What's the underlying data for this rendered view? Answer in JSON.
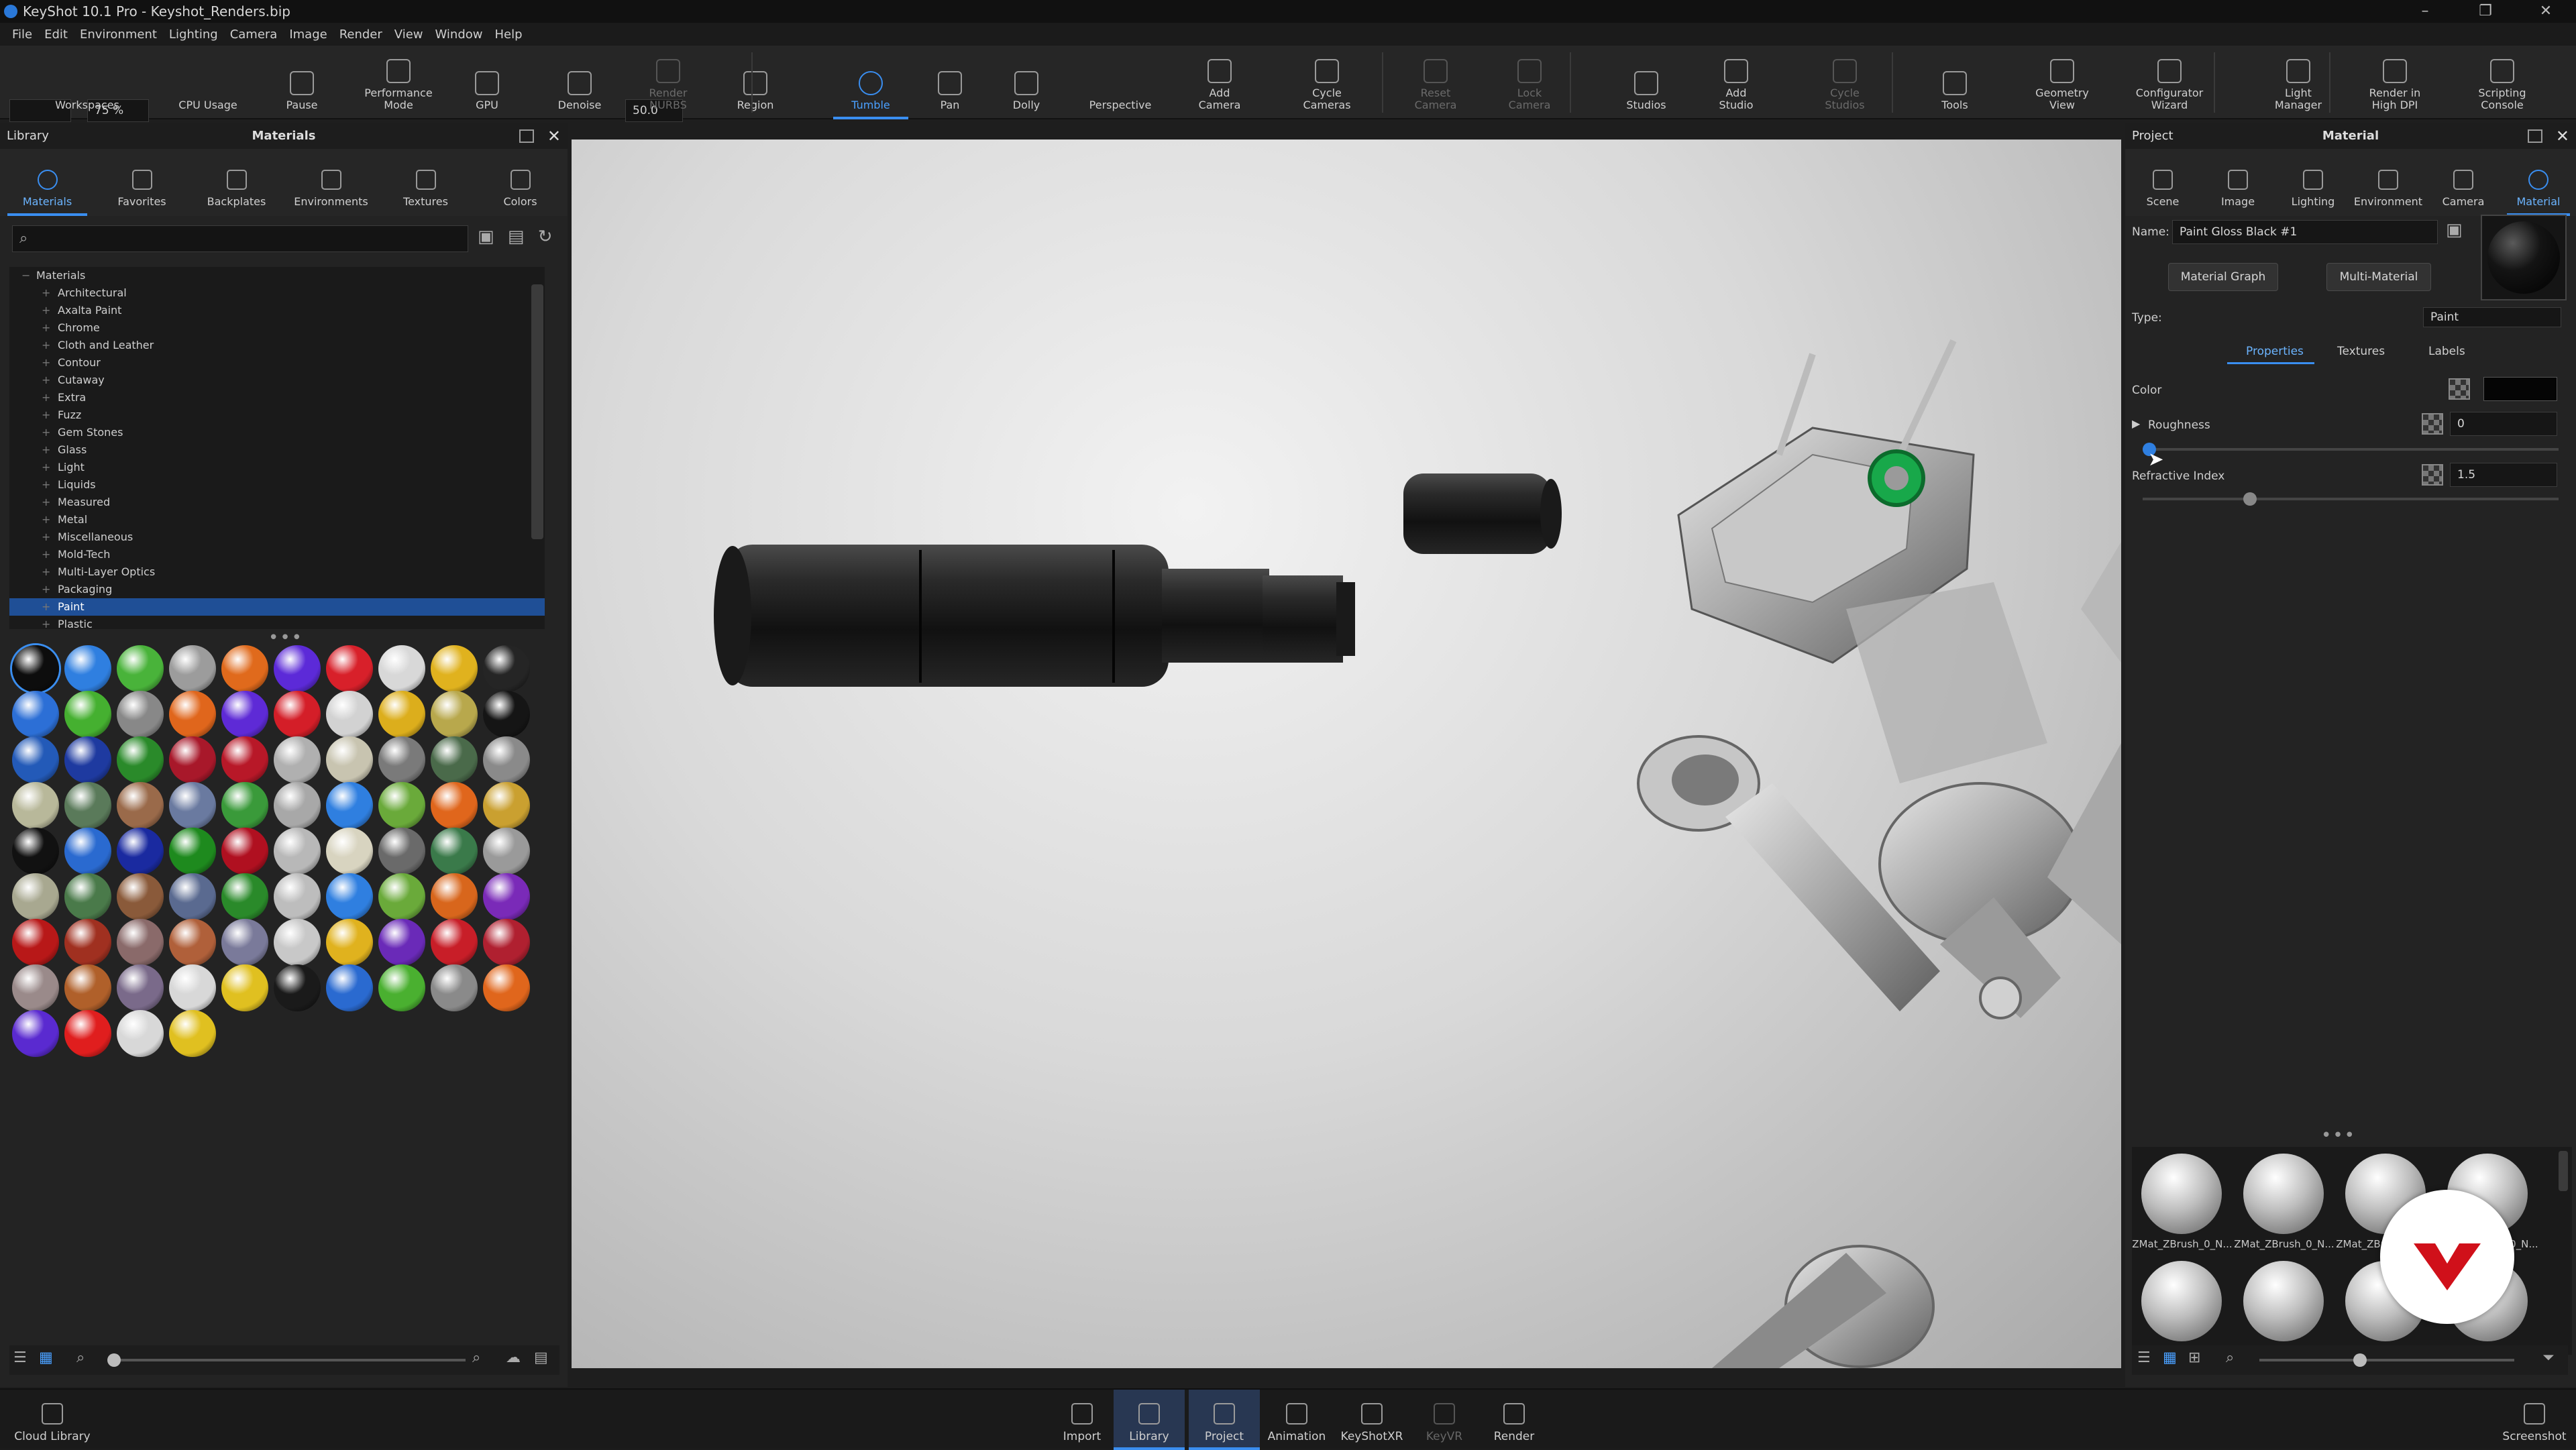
{
  "window": {
    "title": "KeyShot 10.1 Pro  - Keyshot_Renders.bip"
  },
  "menu": [
    "File",
    "Edit",
    "Environment",
    "Lighting",
    "Camera",
    "Image",
    "Render",
    "View",
    "Window",
    "Help"
  ],
  "toolbar": {
    "zoom_value": "75 %",
    "fov_value": "50.0",
    "items": [
      {
        "label": "Workspaces",
        "state": "normal"
      },
      {
        "label": "CPU Usage",
        "state": "normal"
      },
      {
        "label": "Pause",
        "state": "normal"
      },
      {
        "label": "Performance\nMode",
        "state": "normal"
      },
      {
        "label": "GPU",
        "state": "normal"
      },
      {
        "label": "Denoise",
        "state": "normal"
      },
      {
        "label": "Render\nNURBS",
        "state": "disabled"
      },
      {
        "label": "Region",
        "state": "normal"
      },
      {
        "label": "Tumble",
        "state": "active"
      },
      {
        "label": "Pan",
        "state": "normal"
      },
      {
        "label": "Dolly",
        "state": "normal"
      },
      {
        "label": "Perspective",
        "state": "normal"
      },
      {
        "label": "Add\nCamera",
        "state": "normal"
      },
      {
        "label": "Cycle\nCameras",
        "state": "normal"
      },
      {
        "label": "Reset\nCamera",
        "state": "disabled"
      },
      {
        "label": "Lock\nCamera",
        "state": "disabled"
      },
      {
        "label": "Studios",
        "state": "normal"
      },
      {
        "label": "Add\nStudio",
        "state": "normal"
      },
      {
        "label": "Cycle\nStudios",
        "state": "disabled"
      },
      {
        "label": "Tools",
        "state": "normal"
      },
      {
        "label": "Geometry\nView",
        "state": "normal"
      },
      {
        "label": "Configurator\nWizard",
        "state": "normal"
      },
      {
        "label": "Light\nManager",
        "state": "normal"
      },
      {
        "label": "Render in\nHigh DPI",
        "state": "normal"
      },
      {
        "label": "Scripting\nConsole",
        "state": "normal"
      }
    ]
  },
  "library": {
    "header_left": "Library",
    "header_title": "Materials",
    "tabs": [
      {
        "label": "Materials",
        "icon": "materials-icon",
        "active": true
      },
      {
        "label": "Favorites",
        "icon": "star-icon",
        "active": false
      },
      {
        "label": "Backplates",
        "icon": "image-icon",
        "active": false
      },
      {
        "label": "Environments",
        "icon": "globe-icon",
        "active": false
      },
      {
        "label": "Textures",
        "icon": "texture-icon",
        "active": false
      },
      {
        "label": "Colors",
        "icon": "paint-bucket-icon",
        "active": false
      }
    ],
    "search_placeholder": "",
    "tree_root": "Materials",
    "tree": [
      "Architectural",
      "Axalta Paint",
      "Chrome",
      "Cloth and Leather",
      "Contour",
      "Cutaway",
      "Extra",
      "Fuzz",
      "Gem Stones",
      "Glass",
      "Light",
      "Liquids",
      "Measured",
      "Metal",
      "Miscellaneous",
      "Mold-Tech",
      "Multi-Layer Optics",
      "Packaging",
      "Paint",
      "Plastic"
    ],
    "selected": "Paint",
    "swatches": [
      "#0d0d0d",
      "#2f7fe0",
      "#49b33a",
      "#9c9c9c",
      "#e06a1c",
      "#5c2ad8",
      "#d8202a",
      "#d8d8d8",
      "#e0b21e",
      "#252525",
      "#2c6fd6",
      "#45b030",
      "#888888",
      "#e0661c",
      "#5e2ad6",
      "#d41e28",
      "#d2d2d2",
      "#dcae1c",
      "#b8a84c",
      "#151515",
      "#235ab8",
      "#1e3aa0",
      "#2a8a2a",
      "#a8182a",
      "#b81828",
      "#b0b0b0",
      "#c8c4b0",
      "#7a7a7a",
      "#4a6a4a",
      "#8a8a8a",
      "#b8b89a",
      "#5a7a5a",
      "#9a6a4a",
      "#6a7aa0",
      "#3a9a3a",
      "#a8a8a8",
      "#2f7fe0",
      "#6aaa3a",
      "#e0661c",
      "#caa030",
      "#111111",
      "#2a6ad0",
      "#1a2aa0",
      "#1e8a1e",
      "#b01020",
      "#b8b8b8",
      "#d8d4c0",
      "#6a6a6a",
      "#3a7a4a",
      "#9a9a9a",
      "#a8a890",
      "#4a7a4a",
      "#8a5a3a",
      "#5a6a90",
      "#2a8a2a",
      "#bdbdbd",
      "#2f7fe0",
      "#6aaa3a",
      "#d8661c",
      "#7a2ab8",
      "#b81818",
      "#a03020",
      "#8a6a6a",
      "#b0603a",
      "#7a7a9a",
      "#c8c8c8",
      "#e0b21e",
      "#6a2ab8",
      "#c81e28",
      "#b02030",
      "#9a8a8a",
      "#b0602a",
      "#7a6a8a",
      "#d8d8d8",
      "#e0c020",
      "#1a1a1a",
      "#2a6ad0",
      "#4ab030",
      "#8a8a8a",
      "#e0661c",
      "#5a2ad0",
      "#e01e1e",
      "#d8d8d8",
      "#e0c020"
    ],
    "selected_swatch": 0
  },
  "project": {
    "header_left": "Project",
    "header_title": "Material",
    "tabs": [
      {
        "label": "Scene",
        "icon": "scene-icon",
        "active": false
      },
      {
        "label": "Image",
        "icon": "image-icon",
        "active": false
      },
      {
        "label": "Lighting",
        "icon": "bulb-icon",
        "active": false
      },
      {
        "label": "Environment",
        "icon": "globe-icon",
        "active": false
      },
      {
        "label": "Camera",
        "icon": "camera-icon",
        "active": false
      },
      {
        "label": "Material",
        "icon": "material-icon",
        "active": true
      }
    ],
    "name_label": "Name:",
    "name_value": "Paint Gloss Black #1",
    "material_graph": "Material Graph",
    "multi_material": "Multi-Material",
    "type_label": "Type:",
    "type_value": "Paint",
    "subtabs": [
      "Properties",
      "Textures",
      "Labels"
    ],
    "color_label": "Color",
    "color_value": "#050505",
    "roughness_label": "Roughness",
    "roughness_value": "0",
    "roughness_fraction": 0.0,
    "refractive_label": "Refractive Index",
    "refractive_value": "1.5",
    "refractive_fraction": 0.25,
    "thumbs": [
      "ZMat_ZBrush_0_N...",
      "ZMat_ZBrush_0_N...",
      "ZMat_ZBrush_0_N...",
      "ZMat_ZBrush_0_N..."
    ]
  },
  "statusbar": {
    "cloud": "Cloud Library",
    "items": [
      {
        "label": "Import",
        "state": "normal"
      },
      {
        "label": "Library",
        "state": "active"
      },
      {
        "label": "Project",
        "state": "active"
      },
      {
        "label": "Animation",
        "state": "normal"
      },
      {
        "label": "KeyShotXR",
        "state": "normal"
      },
      {
        "label": "KeyVR",
        "state": "disabled"
      },
      {
        "label": "Render",
        "state": "normal"
      }
    ],
    "screenshot": "Screenshot"
  },
  "colors": {
    "accent": "#3a8ef0",
    "selection": "#1f4f96",
    "logo_red": "#d0101a"
  }
}
